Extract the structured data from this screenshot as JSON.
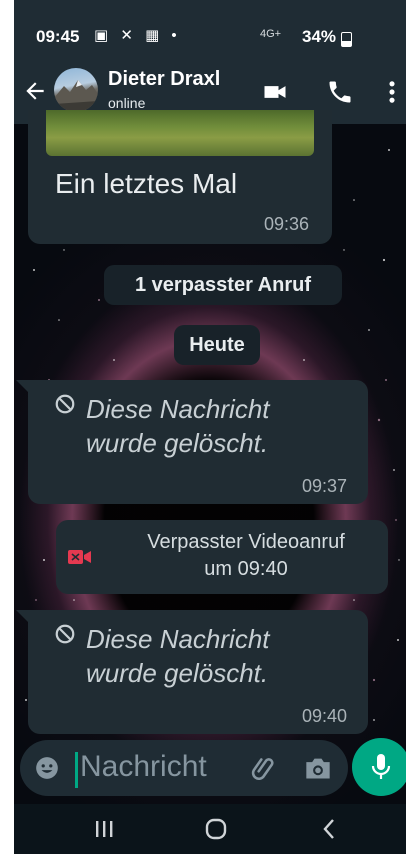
{
  "status_bar": {
    "time": "09:45",
    "left_icons": "▣ ✕ ▦ •",
    "network": "4G+",
    "battery": "34%"
  },
  "header": {
    "name": "Dieter Draxl",
    "status": "online"
  },
  "messages": [
    {
      "type": "image_caption",
      "text": "Ein letztes Mal",
      "time": "09:36"
    },
    {
      "type": "system",
      "text": "1 verpasster Anruf"
    },
    {
      "type": "date",
      "text": "Heute"
    },
    {
      "type": "deleted",
      "line1": "Diese Nachricht",
      "line2": "wurde gelöscht.",
      "time": "09:37"
    },
    {
      "type": "missed_video_call",
      "line1": "Verpasster Videoanruf",
      "line2": "um 09:40"
    },
    {
      "type": "deleted",
      "line1": "Diese Nachricht",
      "line2": "wurde gelöscht.",
      "time": "09:40"
    }
  ],
  "input": {
    "placeholder": "Nachricht"
  },
  "colors": {
    "header_bg": "#1f2c34",
    "bubble_bg": "#202c33",
    "accent": "#00a884",
    "missed_call_icon": "#e53950"
  },
  "icons": {
    "back": "back-arrow-icon",
    "video_call": "video-camera-icon",
    "voice_call": "phone-icon",
    "menu": "more-vert-icon",
    "emoji": "emoji-icon",
    "attach": "paperclip-icon",
    "camera": "camera-icon",
    "mic": "microphone-icon"
  }
}
